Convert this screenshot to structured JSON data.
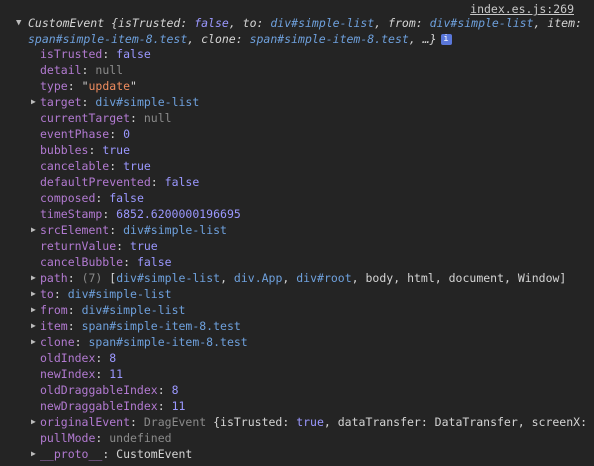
{
  "source": "index.es.js:269",
  "summary": {
    "class_name": "CustomEvent",
    "line1_parts": [
      {
        "text": " {",
        "cls": "kv-key"
      },
      {
        "text": "isTrusted: ",
        "cls": "kv-key"
      },
      {
        "text": "false",
        "cls": "bool"
      },
      {
        "text": ", to: ",
        "cls": "kv-key"
      },
      {
        "text": "div#simple-list",
        "cls": "selector"
      },
      {
        "text": ", from: ",
        "cls": "kv-key"
      },
      {
        "text": "div#simple-list",
        "cls": "selector"
      },
      {
        "text": ", item:",
        "cls": "kv-key"
      }
    ],
    "line2_parts": [
      {
        "text": "span#simple-item-8.test",
        "cls": "selector"
      },
      {
        "text": ", clone: ",
        "cls": "kv-key"
      },
      {
        "text": "span#simple-item-8.test",
        "cls": "selector"
      },
      {
        "text": ", …}",
        "cls": "kv-key"
      }
    ],
    "info": "i"
  },
  "properties": [
    {
      "key": "isTrusted",
      "value": "false",
      "type": "bool",
      "expandable": false
    },
    {
      "key": "detail",
      "value": "null",
      "type": "null",
      "expandable": false
    },
    {
      "key": "type",
      "value": "update",
      "type": "str",
      "expandable": false
    },
    {
      "key": "target",
      "value": "div#simple-list",
      "type": "node",
      "expandable": true
    },
    {
      "key": "currentTarget",
      "value": "null",
      "type": "null",
      "expandable": false
    },
    {
      "key": "eventPhase",
      "value": "0",
      "type": "num",
      "expandable": false
    },
    {
      "key": "bubbles",
      "value": "true",
      "type": "bool",
      "expandable": false
    },
    {
      "key": "cancelable",
      "value": "true",
      "type": "bool",
      "expandable": false
    },
    {
      "key": "defaultPrevented",
      "value": "false",
      "type": "bool",
      "expandable": false
    },
    {
      "key": "composed",
      "value": "false",
      "type": "bool",
      "expandable": false
    },
    {
      "key": "timeStamp",
      "value": "6852.6200000196695",
      "type": "num",
      "expandable": false
    },
    {
      "key": "srcElement",
      "value": "div#simple-list",
      "type": "node",
      "expandable": true
    },
    {
      "key": "returnValue",
      "value": "true",
      "type": "bool",
      "expandable": false
    },
    {
      "key": "cancelBubble",
      "value": "false",
      "type": "bool",
      "expandable": false
    },
    {
      "key": "path",
      "value": "",
      "type": "path",
      "expandable": true,
      "count": "(7)",
      "items": [
        "div#simple-list",
        "div.App",
        "div#root",
        "body",
        "html",
        "document",
        "Window"
      ]
    },
    {
      "key": "to",
      "value": "div#simple-list",
      "type": "node",
      "expandable": true
    },
    {
      "key": "from",
      "value": "div#simple-list",
      "type": "node",
      "expandable": true
    },
    {
      "key": "item",
      "value": "span#simple-item-8.test",
      "type": "node",
      "expandable": true
    },
    {
      "key": "clone",
      "value": "span#simple-item-8.test",
      "type": "node",
      "expandable": true
    },
    {
      "key": "oldIndex",
      "value": "8",
      "type": "num",
      "expandable": false
    },
    {
      "key": "newIndex",
      "value": "11",
      "type": "num",
      "expandable": false
    },
    {
      "key": "oldDraggableIndex",
      "value": "8",
      "type": "num",
      "expandable": false
    },
    {
      "key": "newDraggableIndex",
      "value": "11",
      "type": "num",
      "expandable": false
    },
    {
      "key": "originalEvent",
      "value": "",
      "type": "dragevent",
      "expandable": true,
      "cls_name": "DragEvent",
      "preview": [
        {
          "text": " {isTrusted: ",
          "cls": "v-obj"
        },
        {
          "text": "true",
          "cls": "v-bool"
        },
        {
          "text": ", dataTransfer: DataTransfer, screenX: …",
          "cls": "v-obj"
        }
      ]
    },
    {
      "key": "pullMode",
      "value": "undefined",
      "type": "undef",
      "expandable": false
    },
    {
      "key": "__proto__",
      "value": "CustomEvent",
      "type": "obj",
      "expandable": true
    }
  ],
  "icons": {
    "expanded": "triangle-down-icon",
    "collapsed": "triangle-right-icon",
    "info": "info-icon"
  }
}
